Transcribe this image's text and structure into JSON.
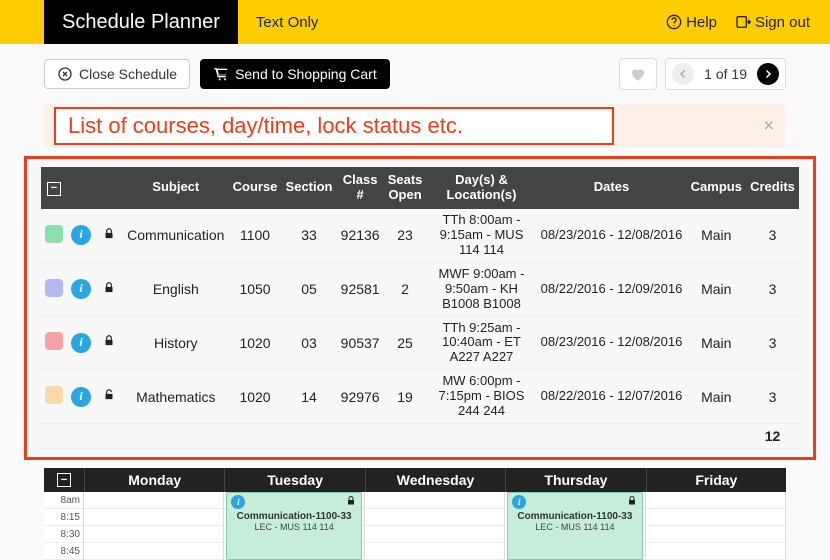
{
  "header": {
    "brand": "Schedule Planner",
    "text_only": "Text Only",
    "help": "Help",
    "signout": "Sign out"
  },
  "actions": {
    "close_schedule": "Close Schedule",
    "send_cart": "Send to Shopping Cart"
  },
  "pager": {
    "label": "1 of 19"
  },
  "alert": {
    "callout": "List of courses, day/time, lock status etc."
  },
  "table": {
    "headers": {
      "subject": "Subject",
      "course": "Course",
      "section": "Section",
      "class_no": "Class\n#",
      "seats": "Seats\nOpen",
      "days_loc": "Day(s) &\nLocation(s)",
      "dates": "Dates",
      "campus": "Campus",
      "credits": "Credits"
    },
    "rows": [
      {
        "color": "#8edfae",
        "locked": true,
        "subject": "Communication",
        "course": "1100",
        "section": "33",
        "class_no": "92136",
        "seats": "23",
        "days_loc": "TTh 8:00am - 9:15am - MUS 114 114",
        "dates": "08/23/2016 - 12/08/2016",
        "campus": "Main",
        "credits": "3"
      },
      {
        "color": "#b4b8f0",
        "locked": true,
        "subject": "English",
        "course": "1050",
        "section": "05",
        "class_no": "92581",
        "seats": "2",
        "days_loc": "MWF 9:00am - 9:50am - KH B1008 B1008",
        "dates": "08/22/2016 - 12/09/2016",
        "campus": "Main",
        "credits": "3"
      },
      {
        "color": "#f4a4a4",
        "locked": true,
        "subject": "History",
        "course": "1020",
        "section": "03",
        "class_no": "90537",
        "seats": "25",
        "days_loc": "TTh 9:25am - 10:40am - ET A227 A227",
        "dates": "08/23/2016 - 12/08/2016",
        "campus": "Main",
        "credits": "3"
      },
      {
        "color": "#f9d9a8",
        "locked": false,
        "subject": "Mathematics",
        "course": "1020",
        "section": "14",
        "class_no": "92976",
        "seats": "19",
        "days_loc": "MW 6:00pm - 7:15pm - BIOS 244 244",
        "dates": "08/22/2016 - 12/07/2016",
        "campus": "Main",
        "credits": "3"
      }
    ],
    "total_credits": "12"
  },
  "week": {
    "days": [
      "Monday",
      "Tuesday",
      "Wednesday",
      "Thursday",
      "Friday"
    ],
    "times": [
      "8am",
      "8:15",
      "8:30",
      "8:45"
    ],
    "events": {
      "tuesday": {
        "title": "Communication-1100-33",
        "loc": "LEC - MUS 114 114"
      },
      "thursday": {
        "title": "Communication-1100-33",
        "loc": "LEC - MUS 114 114"
      }
    }
  }
}
